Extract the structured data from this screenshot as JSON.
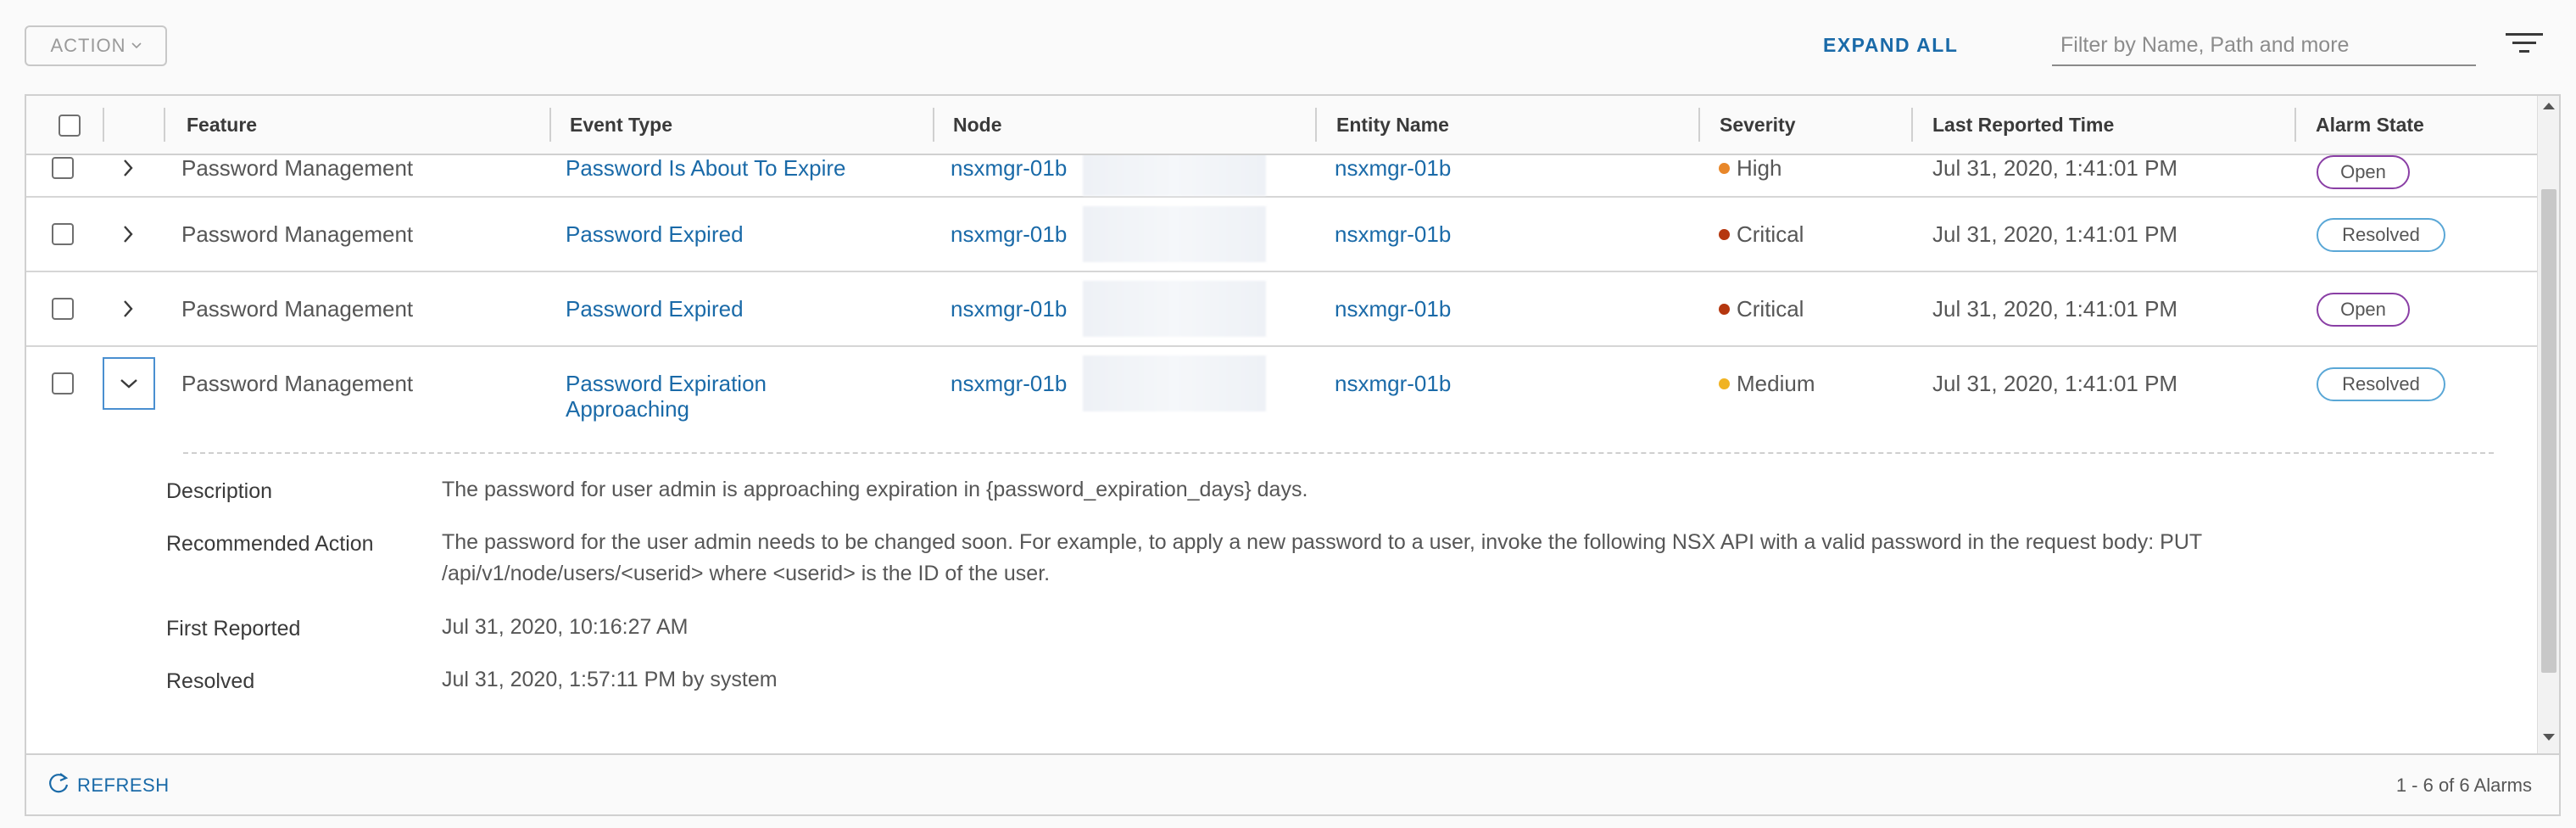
{
  "toolbar": {
    "action_label": "ACTION",
    "expand_all_label": "EXPAND ALL",
    "filter_placeholder": "Filter by Name, Path and more"
  },
  "columns": {
    "feature": "Feature",
    "event_type": "Event Type",
    "node": "Node",
    "entity_name": "Entity Name",
    "severity": "Severity",
    "last_reported": "Last Reported Time",
    "alarm_state": "Alarm State"
  },
  "rows": [
    {
      "feature": "Password Management",
      "event_type": "Password Is About To Expire",
      "node": "nsxmgr-01b",
      "entity": "nsxmgr-01b",
      "severity": "High",
      "severity_color": "#e8872a",
      "last_reported": "Jul 31, 2020, 1:41:01 PM",
      "state": "Open"
    },
    {
      "feature": "Password Management",
      "event_type": "Password Expired",
      "node": "nsxmgr-01b",
      "entity": "nsxmgr-01b",
      "severity": "Critical",
      "severity_color": "#b5370f",
      "last_reported": "Jul 31, 2020, 1:41:01 PM",
      "state": "Resolved"
    },
    {
      "feature": "Password Management",
      "event_type": "Password Expired",
      "node": "nsxmgr-01b",
      "entity": "nsxmgr-01b",
      "severity": "Critical",
      "severity_color": "#b5370f",
      "last_reported": "Jul 31, 2020, 1:41:01 PM",
      "state": "Open"
    },
    {
      "feature": "Password Management",
      "event_type_line1": "Password Expiration",
      "event_type_line2": "Approaching",
      "node": "nsxmgr-01b",
      "entity": "nsxmgr-01b",
      "severity": "Medium",
      "severity_color": "#f0b323",
      "last_reported": "Jul 31, 2020, 1:41:01 PM",
      "state": "Resolved"
    }
  ],
  "details": {
    "description_label": "Description",
    "description": "The password for user admin is approaching expiration in {password_expiration_days} days.",
    "recommended_label": "Recommended Action",
    "recommended_line1": "The password for the user admin needs to be changed soon. For example, to apply a new password to a user, invoke the following NSX API with a valid password in the request body: PUT",
    "recommended_line2": "/api/v1/node/users/<userid> where <userid> is the ID of the user.",
    "first_reported_label": "First Reported",
    "first_reported": "Jul 31, 2020, 10:16:27 AM",
    "resolved_label": "Resolved",
    "resolved": "Jul 31, 2020, 1:57:11 PM by system"
  },
  "footer": {
    "refresh_label": "REFRESH",
    "pagination": "1 - 6 of 6 Alarms"
  },
  "colors": {
    "link": "#1a6aa8",
    "open_border": "#8a3fa5",
    "resolved_border": "#5aa7d6"
  },
  "icons": {
    "action_chevron": "chevron-down-icon",
    "filter": "filter-lines-icon",
    "row_expand": "chevron-right-icon",
    "row_collapse": "chevron-down-icon",
    "refresh": "refresh-icon"
  }
}
